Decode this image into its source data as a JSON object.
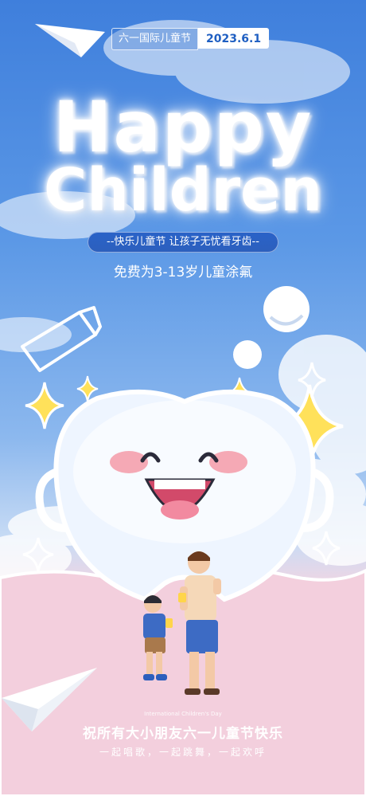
{
  "header": {
    "event_label": "六一国际儿童节",
    "date": "2023.6.1"
  },
  "headline": {
    "line1": "Happy",
    "line2": "Children"
  },
  "tagline": "--快乐儿童节 让孩子无忧看牙齿--",
  "offer": "免费为3-13岁儿童涂氟",
  "footer": {
    "english_caption": "International Children's Day",
    "greeting": "祝所有大小朋友六一儿童节快乐",
    "slogan": "一起唱歌，一起跳舞，一起欢呼"
  },
  "colors": {
    "sky_top": "#3f7fdc",
    "ground_pink": "#f5c9d8",
    "star_yellow": "#ffe15a",
    "pill_blue": "#2a63c8"
  }
}
